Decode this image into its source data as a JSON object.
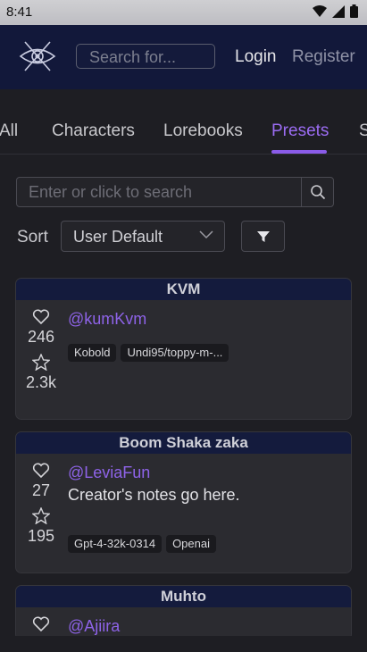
{
  "status": {
    "time": "8:41"
  },
  "header": {
    "search_placeholder": "Search for...",
    "login": "Login",
    "register": "Register"
  },
  "tabs": [
    {
      "label": "All"
    },
    {
      "label": "Characters"
    },
    {
      "label": "Lorebooks"
    },
    {
      "label": "Presets",
      "active": true
    },
    {
      "label": "S"
    }
  ],
  "search": {
    "placeholder": "Enter or click to search"
  },
  "sort": {
    "label": "Sort",
    "value": "User Default"
  },
  "cards": [
    {
      "title": "KVM",
      "author": "@kumKvm",
      "likes": "246",
      "stars": "2.3k",
      "notes": "",
      "tags": [
        "Kobold",
        "Undi95/toppy-m-..."
      ]
    },
    {
      "title": "Boom Shaka zaka",
      "author": "@LeviaFun",
      "likes": "27",
      "stars": "195",
      "notes": "Creator's notes go here.",
      "tags": [
        "Gpt-4-32k-0314",
        "Openai"
      ]
    },
    {
      "title": "Muhto",
      "author": "@Ajiira",
      "likes": "",
      "stars": "",
      "notes": "",
      "tags": []
    }
  ],
  "colors": {
    "accent": "#8a5be8",
    "header_bg": "#12183a",
    "card_title_bg": "#141b3d"
  }
}
